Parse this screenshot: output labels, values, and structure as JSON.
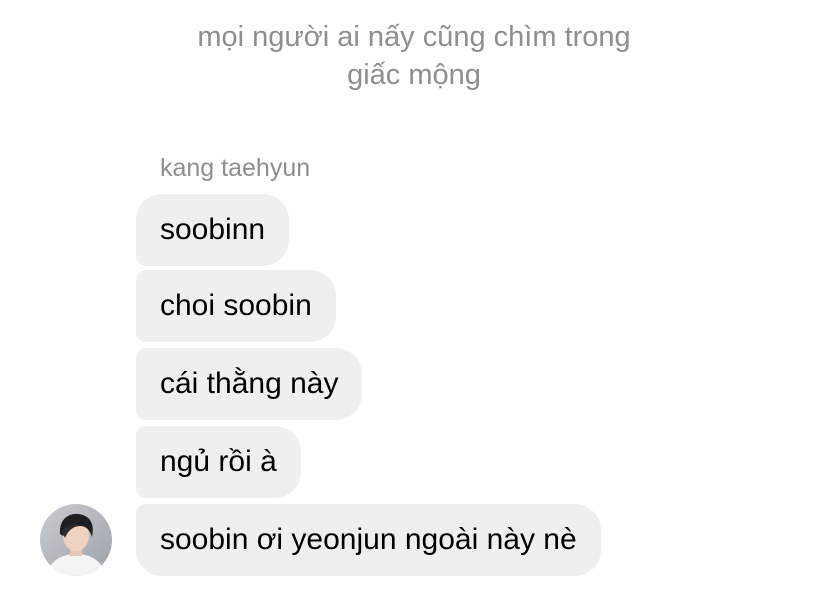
{
  "system_note": {
    "line1": "mọi người ai nấy cũng chìm trong",
    "line2": "giấc mộng"
  },
  "sender": {
    "name": "kang taehyun",
    "avatar_icon": "profile-photo-avatar"
  },
  "messages": [
    "soobinn",
    "choi soobin",
    "cái thằng này",
    "ngủ rồi à",
    "soobin ơi yeonjun ngoài này nè"
  ],
  "colors": {
    "bubble_bg": "#efefef",
    "meta_text": "#8e8e8e",
    "message_text": "#000000"
  }
}
